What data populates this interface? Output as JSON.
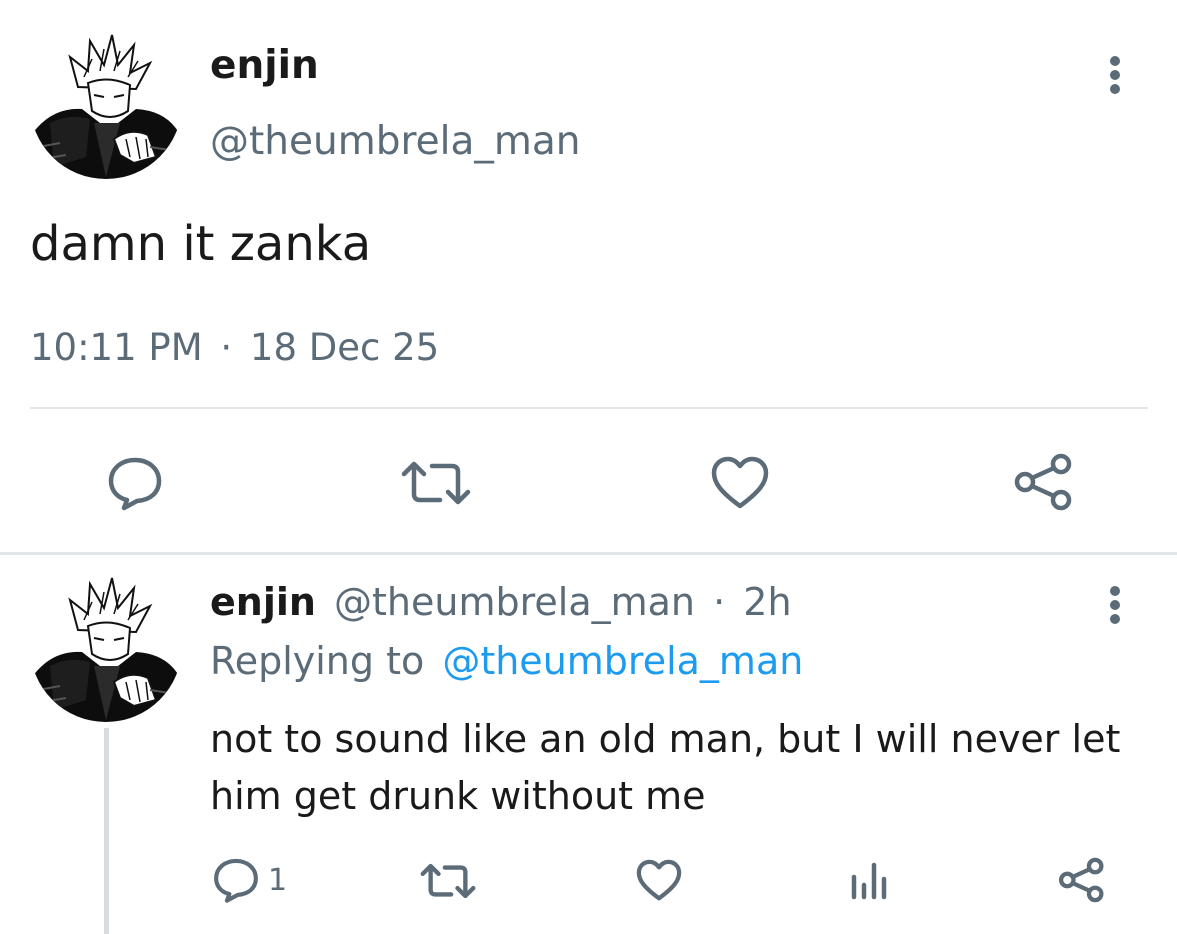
{
  "main_tweet": {
    "author_name": "enjin",
    "author_handle": "@theumbrela_man",
    "text": "damn it zanka",
    "time": "10:11 PM",
    "separator": "·",
    "date": "18 Dec 25",
    "icons": {
      "more": "more-vertical-icon",
      "reply": "reply-icon",
      "retweet": "retweet-icon",
      "like": "heart-icon",
      "share": "share-icon"
    }
  },
  "reply_tweet": {
    "author_name": "enjin",
    "author_handle": "@theumbrela_man",
    "separator": "·",
    "age": "2h",
    "replying_label": "Replying to",
    "replying_handle": "@theumbrela_man",
    "text_line1": "not to sound like an old man, but I will never let",
    "text_line2": "him get drunk without me",
    "reply_count": "1",
    "icons": {
      "more": "more-vertical-icon",
      "reply": "reply-icon",
      "retweet": "retweet-icon",
      "like": "heart-icon",
      "views": "analytics-icon",
      "share": "share-icon"
    }
  },
  "colors": {
    "text": "#1a1a1a",
    "muted": "#5b6b78",
    "link": "#1d9bf0",
    "divider": "#e3e6e9"
  }
}
